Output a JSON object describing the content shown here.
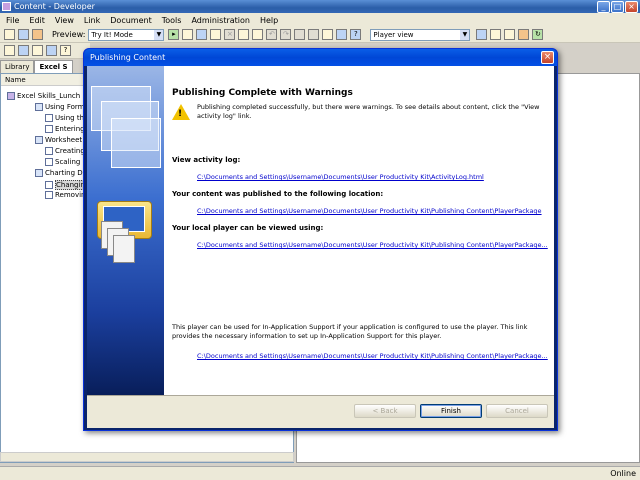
{
  "app": {
    "title": "Content - Developer",
    "status_online": "Online"
  },
  "menu": [
    "File",
    "Edit",
    "View",
    "Link",
    "Document",
    "Tools",
    "Administration",
    "Help"
  ],
  "toolbar": {
    "preview_label": "Preview:",
    "preview_mode": "Try It! Mode",
    "player_view": "Player view"
  },
  "tabs": [
    "Library",
    "Excel S"
  ],
  "tree": {
    "column_header": "Name",
    "items": [
      "Excel Skills_Lunch",
      "Using Formul",
      "Using the",
      "Entering",
      "Worksheet A",
      "Creating",
      "Scaling a",
      "Charting Dat",
      "Changing",
      "Removin"
    ]
  },
  "dialog": {
    "title": "Publishing Content",
    "heading": "Publishing Complete with Warnings",
    "warning_text": "Publishing completed successfully, but there were warnings. To see details about content, click the \"View activity log\" link.",
    "view_log_label": "View activity log:",
    "log_link": "C:\\Documents and Settings\\Username\\Documents\\User Productivity Kit\\ActivityLog.html",
    "location_label": "Your content was published to the following location:",
    "location_link": "C:\\Documents and Settings\\Username\\Documents\\User Productivity Kit\\Publishing Content\\PlayerPackage",
    "player_label": "Your local player can be viewed using:",
    "player_link": "C:\\Documents and Settings\\Username\\Documents\\User Productivity Kit\\Publishing Content\\PlayerPackage...",
    "info_text": "This player can be used for In-Application Support if your application is configured to use the player. This link provides the necessary information to set up In-Application Support for this player.",
    "info_link": "C:\\Documents and Settings\\Username\\Documents\\User Productivity Kit\\Publishing Content\\PlayerPackage...",
    "back_button": "< Back",
    "finish_button": "Finish",
    "cancel_button": "Cancel"
  }
}
